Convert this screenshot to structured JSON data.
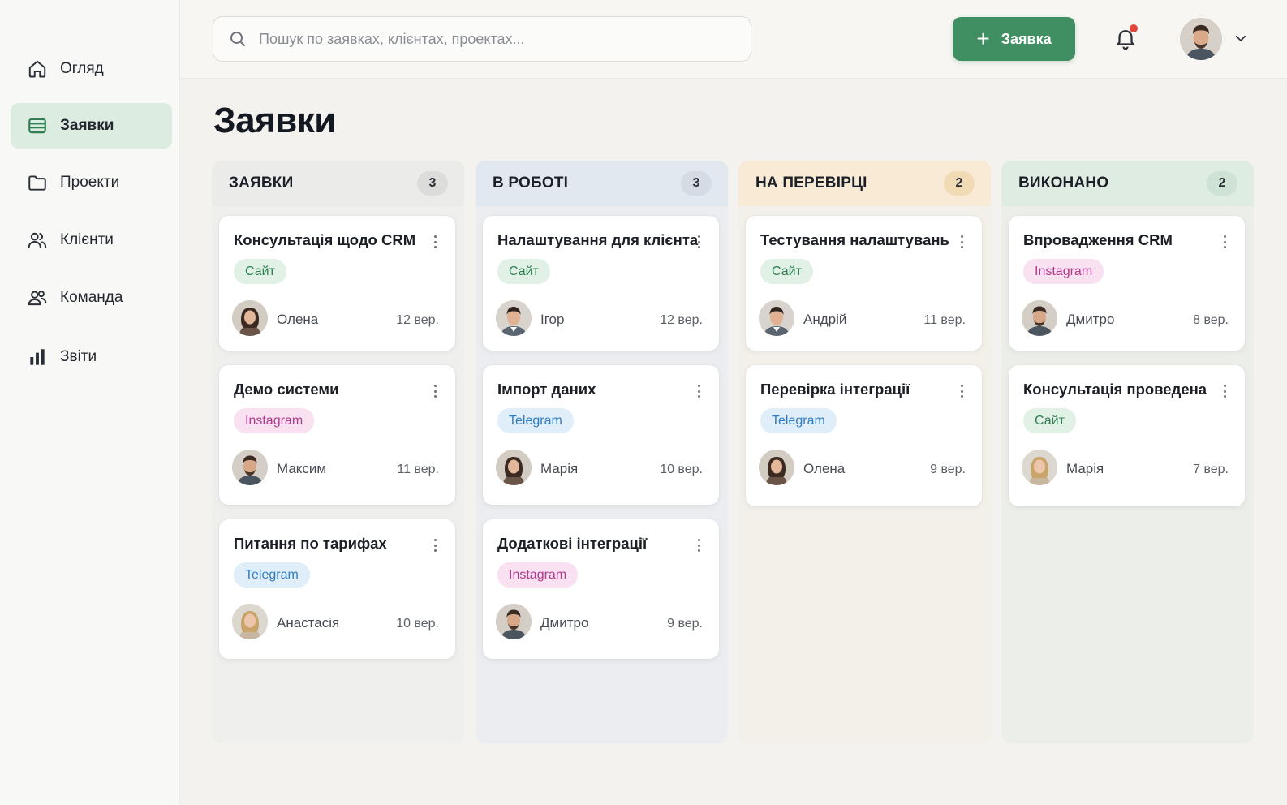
{
  "sidebar": {
    "items": [
      {
        "label": "Огляд",
        "icon": "home-icon",
        "active": false
      },
      {
        "label": "Заявки",
        "icon": "card-icon",
        "active": true
      },
      {
        "label": "Проекти",
        "icon": "folder-icon",
        "active": false
      },
      {
        "label": "Клієнти",
        "icon": "users-icon",
        "active": false
      },
      {
        "label": "Команда",
        "icon": "team-icon",
        "active": false
      },
      {
        "label": "Звіти",
        "icon": "bar-chart-icon",
        "active": false
      }
    ]
  },
  "header": {
    "search_placeholder": "Пошук по заявках, клієнтах, проектах...",
    "search_value": "",
    "new_button_label": "Заявка",
    "notification_unread": true,
    "accent_color": "#3f8f62"
  },
  "page": {
    "title": "Заявки"
  },
  "board": {
    "columns": [
      {
        "title": "ЗАЯВКИ",
        "count": "3",
        "header_bg": "#ebebea",
        "body_bg": "#efefed",
        "count_bg": "#dcdcda",
        "cards": [
          {
            "title": "Консультація щодо CRM",
            "tag": "Сайт",
            "tag_type": "site",
            "person": "Олена",
            "date": "12 вер.",
            "avatar": "female-dark"
          },
          {
            "title": "Демо системи",
            "tag": "Instagram",
            "tag_type": "insta",
            "person": "Максим",
            "date": "11 вер.",
            "avatar": "male-beard"
          },
          {
            "title": "Питання по тарифах",
            "tag": "Telegram",
            "tag_type": "tg",
            "person": "Анастасія",
            "date": "10 вер.",
            "avatar": "female-blonde"
          }
        ]
      },
      {
        "title": "В РОБОТІ",
        "count": "3",
        "header_bg": "#e1e8f0",
        "body_bg": "#ebedf0",
        "count_bg": "#d4dbe4",
        "cards": [
          {
            "title": "Налаштування для клієнта",
            "tag": "Сайт",
            "tag_type": "site",
            "person": "Ігор",
            "date": "12 вер.",
            "avatar": "male-short"
          },
          {
            "title": "Імпорт даних",
            "tag": "Telegram",
            "tag_type": "tg",
            "person": "Марія",
            "date": "10 вер.",
            "avatar": "female-dark"
          },
          {
            "title": "Додаткові інтеграції",
            "tag": "Instagram",
            "tag_type": "insta",
            "person": "Дмитро",
            "date": "9 вер.",
            "avatar": "male-beard"
          }
        ]
      },
      {
        "title": "НА ПЕРЕВІРЦІ",
        "count": "2",
        "header_bg": "#f8ead4",
        "body_bg": "#f3f0ea",
        "count_bg": "#f1dbb5",
        "cards": [
          {
            "title": "Тестування налаштувань",
            "tag": "Сайт",
            "tag_type": "site",
            "person": "Андрій",
            "date": "11 вер.",
            "avatar": "male-short"
          },
          {
            "title": "Перевірка інтеграції",
            "tag": "Telegram",
            "tag_type": "tg",
            "person": "Олена",
            "date": "9 вер.",
            "avatar": "female-dark"
          }
        ]
      },
      {
        "title": "ВИКОНАНО",
        "count": "2",
        "header_bg": "#dfece2",
        "body_bg": "#eceeea",
        "count_bg": "#cfe3d4",
        "cards": [
          {
            "title": "Впровадження CRM",
            "tag": "Instagram",
            "tag_type": "insta",
            "person": "Дмитро",
            "date": "8 вер.",
            "avatar": "male-beard"
          },
          {
            "title": "Консультація проведена",
            "tag": "Сайт",
            "tag_type": "site",
            "person": "Марія",
            "date": "7 вер.",
            "avatar": "female-blonde"
          }
        ]
      }
    ]
  }
}
